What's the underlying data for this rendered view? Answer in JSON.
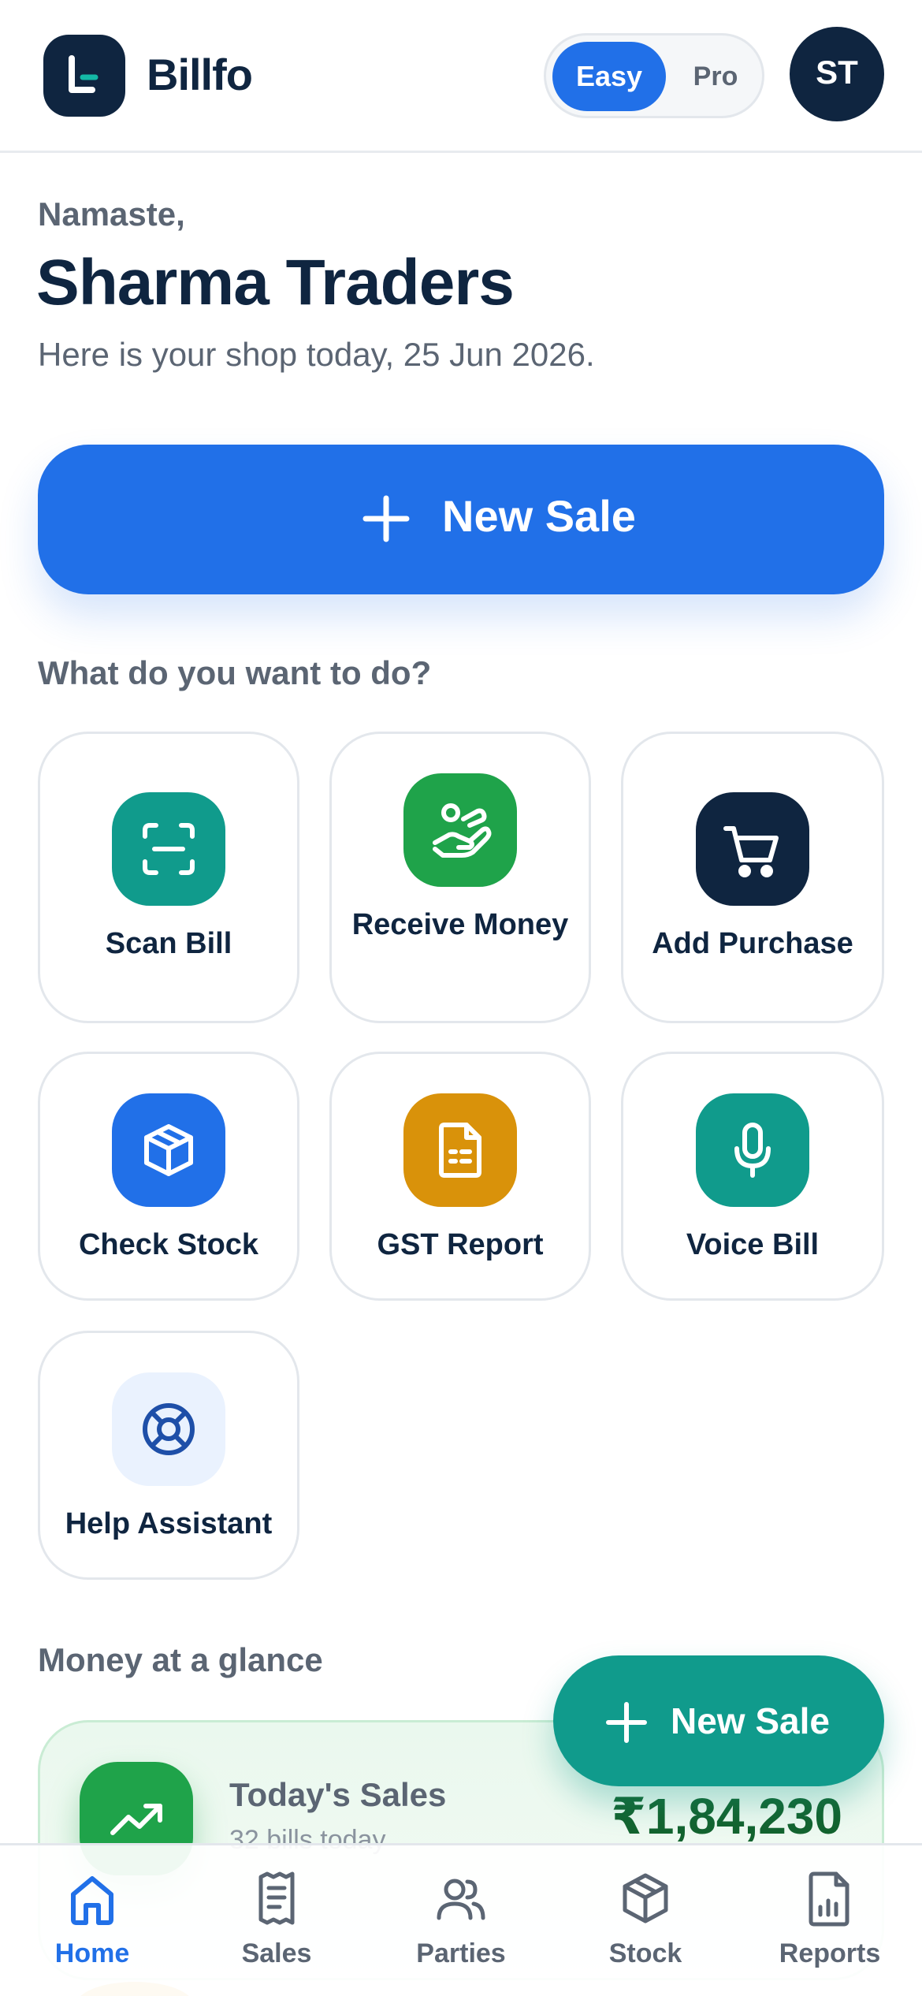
{
  "header": {
    "brand": "Billfo",
    "mode": {
      "easy": "Easy",
      "pro": "Pro",
      "selected": "Easy"
    },
    "avatar_initials": "ST"
  },
  "greeting": {
    "salutation": "Namaste,",
    "shop_name": "Sharma Traders",
    "subtitle": "Here is your shop today, 25 Jun 2026."
  },
  "primary_action": {
    "label": "New Sale",
    "icon": "plus-icon"
  },
  "actions": {
    "title": "What do you want to do?",
    "items": [
      {
        "label": "Scan Bill",
        "icon": "scan-icon",
        "color": "#109b8c"
      },
      {
        "label": "Receive Money",
        "icon": "hand-money-icon",
        "color": "#1fa34a"
      },
      {
        "label": "Add Purchase",
        "icon": "cart-icon",
        "color": "#0f2540"
      },
      {
        "label": "Check Stock",
        "icon": "box-icon",
        "color": "#2170e8"
      },
      {
        "label": "GST Report",
        "icon": "document-icon",
        "color": "#d9920a"
      },
      {
        "label": "Voice Bill",
        "icon": "microphone-icon",
        "color": "#109b8c"
      },
      {
        "label": "Help Assistant",
        "icon": "lifebuoy-icon",
        "color": "#eaf2fe"
      }
    ]
  },
  "money": {
    "title": "Money at a glance",
    "today_sales": {
      "label": "Today's Sales",
      "sub": "32 bills today",
      "value": "₹1,84,230",
      "icon": "trend-up-icon",
      "color": "#1fa34a"
    }
  },
  "fab": {
    "label": "New Sale",
    "icon": "plus-icon"
  },
  "bottom_nav": {
    "active": "Home",
    "items": [
      {
        "label": "Home",
        "icon": "home-icon"
      },
      {
        "label": "Sales",
        "icon": "receipt-icon"
      },
      {
        "label": "Parties",
        "icon": "users-icon"
      },
      {
        "label": "Stock",
        "icon": "box-icon"
      },
      {
        "label": "Reports",
        "icon": "report-icon"
      }
    ]
  },
  "colors": {
    "primary": "#2170e8",
    "navy": "#0f2540",
    "teal": "#109b8c",
    "green": "#1fa34a",
    "amber": "#d9920a",
    "muted_text": "#5b6573"
  }
}
